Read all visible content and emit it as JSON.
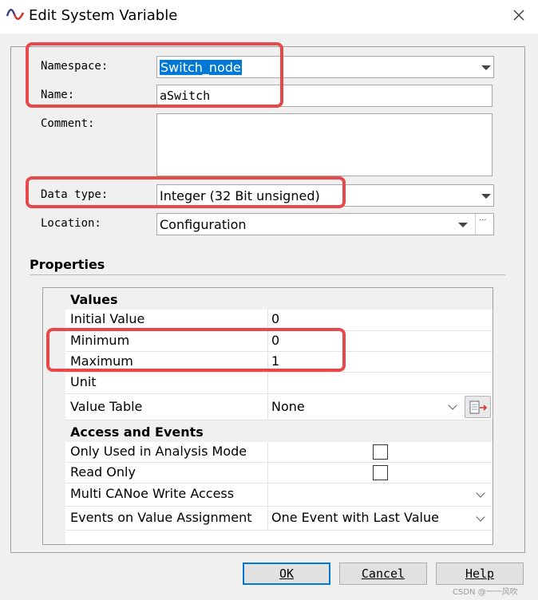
{
  "window": {
    "title": "Edit System Variable",
    "close_icon": "close-icon",
    "app_icon": "sine-wave-icon"
  },
  "form": {
    "namespace_label": "Namespace:",
    "namespace_value": "Switch_node",
    "name_label": "Name:",
    "name_value": "aSwitch",
    "comment_label": "Comment:",
    "comment_value": "",
    "datatype_label": "Data type:",
    "datatype_value": "Integer (32 Bit unsigned)",
    "location_label": "Location:",
    "location_value": "Configuration",
    "location_browse": "···"
  },
  "properties": {
    "title": "Properties",
    "groups": {
      "values": "Values",
      "access": "Access and Events"
    },
    "rows": {
      "initial_value": {
        "key": "Initial Value",
        "value": "0"
      },
      "minimum": {
        "key": "Minimum",
        "value": "0"
      },
      "maximum": {
        "key": "Maximum",
        "value": "1"
      },
      "unit": {
        "key": "Unit",
        "value": ""
      },
      "value_table": {
        "key": "Value Table",
        "value": "None"
      },
      "analysis_mode": {
        "key": "Only Used in Analysis Mode",
        "checked": false
      },
      "read_only": {
        "key": "Read Only",
        "checked": false
      },
      "multi_write": {
        "key": "Multi CANoe Write Access",
        "value": ""
      },
      "events": {
        "key": "Events on Value Assignment",
        "value": "One Event with Last Value"
      }
    }
  },
  "buttons": {
    "ok": "OK",
    "cancel": "Cancel",
    "help": "Help"
  },
  "watermark": "CSDN @一一风吹",
  "colors": {
    "highlight": "#e8484a",
    "selection": "#0078d7",
    "accent": "#0078d7"
  }
}
